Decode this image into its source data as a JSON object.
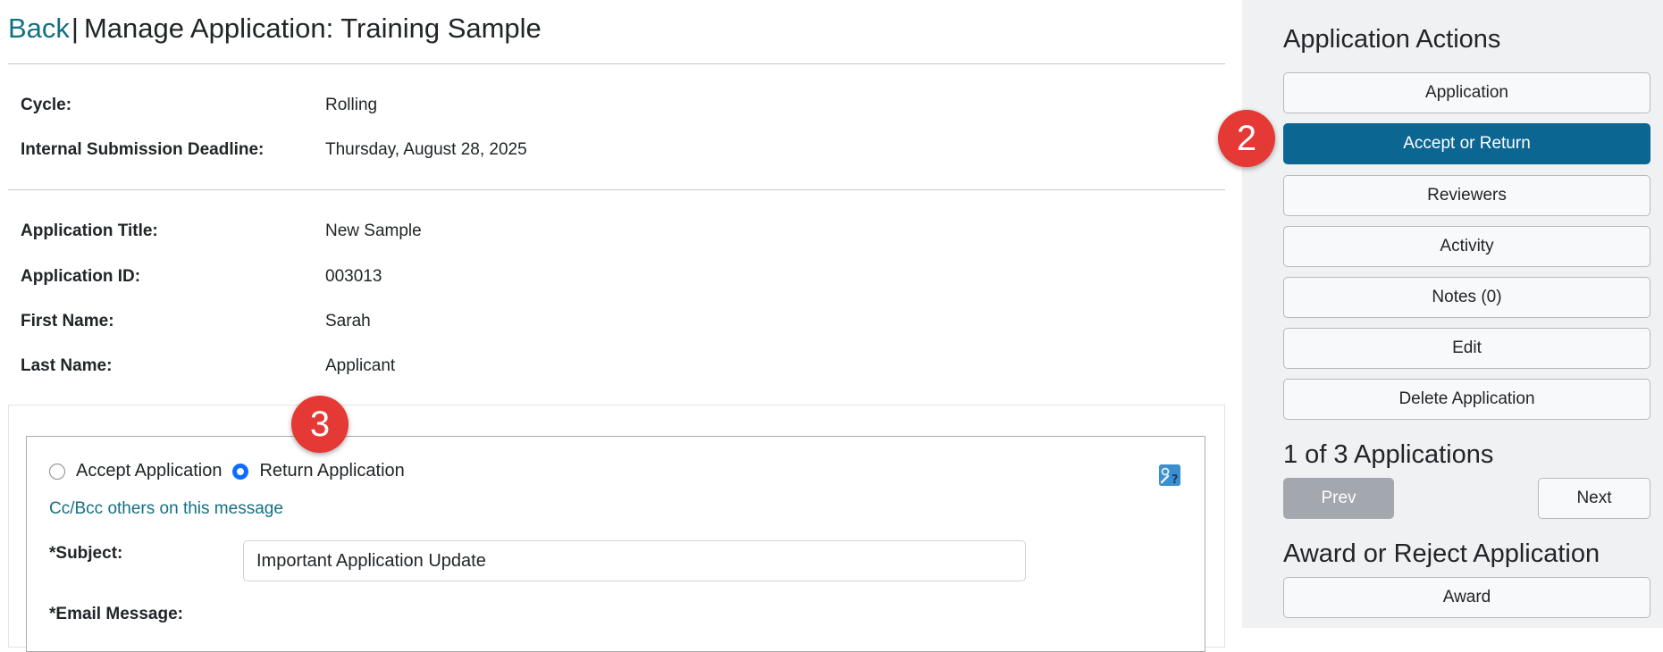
{
  "header": {
    "back_label": "Back",
    "separator": "|",
    "title": "Manage Application: Training Sample"
  },
  "cycle": {
    "label": "Cycle:",
    "value": "Rolling"
  },
  "deadline": {
    "label": "Internal Submission Deadline:",
    "value": "Thursday, August 28, 2025"
  },
  "details": [
    {
      "label": "Application Title:",
      "value": "New Sample"
    },
    {
      "label": "Application ID:",
      "value": "003013"
    },
    {
      "label": "First Name:",
      "value": "Sarah"
    },
    {
      "label": "Last Name:",
      "value": "Applicant"
    }
  ],
  "form": {
    "radio_accept": "Accept Application",
    "radio_return": "Return Application",
    "selected": "Return Application",
    "cc_link": "Cc/Bcc others on this message",
    "subject_label": "*Subject:",
    "subject_value": "Important Application Update",
    "email_label": "*Email Message:"
  },
  "badges": {
    "step2": "2",
    "step3": "3"
  },
  "sidebar": {
    "actions_heading": "Application Actions",
    "actions": [
      "Application",
      "Accept or Return",
      "Reviewers",
      "Activity",
      "Notes (0)",
      "Edit",
      "Delete Application"
    ],
    "active_action": "Accept or Return",
    "pager_heading": "1 of 3 Applications",
    "prev_label": "Prev",
    "next_label": "Next",
    "award_heading": "Award or Reject Application",
    "award_label": "Award"
  },
  "colors": {
    "link": "#137081",
    "primary_button": "#0c6692",
    "badge": "#e53935",
    "sidebar_bg": "#f0f1f2",
    "radio_checked": "#0d6efd"
  },
  "icons": {
    "help": "help-icon"
  }
}
